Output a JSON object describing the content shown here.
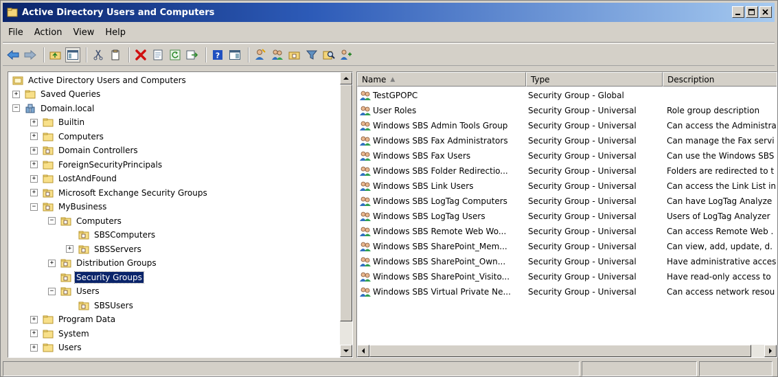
{
  "window": {
    "title": "Active Directory Users and Computers",
    "title_bar_color": "#0a246a"
  },
  "menu": {
    "items": [
      "File",
      "Action",
      "View",
      "Help"
    ]
  },
  "toolbar": {
    "icons": [
      "back-icon",
      "forward-icon",
      "up-folder-icon",
      "show-console-tree-icon",
      "cut-icon",
      "copy-icon",
      "delete-icon",
      "properties-icon",
      "refresh-icon",
      "export-list-icon",
      "help-icon",
      "show-pane-icon",
      "new-user-icon",
      "new-group-icon",
      "new-ou-icon",
      "filter-icon",
      "find-icon",
      "add-to-group-icon"
    ]
  },
  "tree": {
    "root": "Active Directory Users and Computers",
    "items": [
      {
        "label": "Active Directory Users and Computers",
        "depth": 0,
        "expander": "",
        "icon": "console-icon"
      },
      {
        "label": "Saved Queries",
        "depth": 0,
        "expander": "+",
        "icon": "folder-icon"
      },
      {
        "label": "Domain.local",
        "depth": 0,
        "expander": "−",
        "icon": "domain-icon"
      },
      {
        "label": "Builtin",
        "depth": 1,
        "expander": "+",
        "icon": "folder-icon"
      },
      {
        "label": "Computers",
        "depth": 1,
        "expander": "+",
        "icon": "folder-icon"
      },
      {
        "label": "Domain Controllers",
        "depth": 1,
        "expander": "+",
        "icon": "ou-icon"
      },
      {
        "label": "ForeignSecurityPrincipals",
        "depth": 1,
        "expander": "+",
        "icon": "folder-icon"
      },
      {
        "label": "LostAndFound",
        "depth": 1,
        "expander": "+",
        "icon": "folder-icon"
      },
      {
        "label": "Microsoft Exchange Security Groups",
        "depth": 1,
        "expander": "+",
        "icon": "ou-icon"
      },
      {
        "label": "MyBusiness",
        "depth": 1,
        "expander": "−",
        "icon": "ou-icon"
      },
      {
        "label": "Computers",
        "depth": 2,
        "expander": "−",
        "icon": "ou-icon"
      },
      {
        "label": "SBSComputers",
        "depth": 3,
        "expander": "",
        "icon": "ou-icon"
      },
      {
        "label": "SBSServers",
        "depth": 3,
        "expander": "+",
        "icon": "ou-icon"
      },
      {
        "label": "Distribution Groups",
        "depth": 2,
        "expander": "+",
        "icon": "ou-icon"
      },
      {
        "label": "Security Groups",
        "depth": 2,
        "expander": "",
        "icon": "ou-icon",
        "selected": true
      },
      {
        "label": "Users",
        "depth": 2,
        "expander": "−",
        "icon": "ou-icon"
      },
      {
        "label": "SBSUsers",
        "depth": 3,
        "expander": "",
        "icon": "ou-icon"
      },
      {
        "label": "Program Data",
        "depth": 1,
        "expander": "+",
        "icon": "folder-icon"
      },
      {
        "label": "System",
        "depth": 1,
        "expander": "+",
        "icon": "folder-icon"
      },
      {
        "label": "Users",
        "depth": 1,
        "expander": "+",
        "icon": "folder-icon"
      }
    ]
  },
  "list": {
    "columns": [
      "Name",
      "Type",
      "Description"
    ],
    "sort_indicator": "▲",
    "rows": [
      {
        "name": "TestGPOPC",
        "type": "Security Group - Global",
        "description": ""
      },
      {
        "name": "User Roles",
        "type": "Security Group - Universal",
        "description": "Role group description"
      },
      {
        "name": "Windows SBS Admin Tools Group",
        "type": "Security Group - Universal",
        "description": "Can access the Administra"
      },
      {
        "name": "Windows SBS Fax Administrators",
        "type": "Security Group - Universal",
        "description": "Can manage the Fax servi"
      },
      {
        "name": "Windows SBS Fax Users",
        "type": "Security Group - Universal",
        "description": "Can use the Windows SBS"
      },
      {
        "name": "Windows SBS Folder Redirectio...",
        "type": "Security Group - Universal",
        "description": "Folders are redirected to t"
      },
      {
        "name": "Windows SBS Link Users",
        "type": "Security Group - Universal",
        "description": "Can access the Link List in"
      },
      {
        "name": "Windows SBS LogTag Computers",
        "type": "Security Group - Universal",
        "description": "Can have LogTag Analyze"
      },
      {
        "name": "Windows SBS LogTag Users",
        "type": "Security Group - Universal",
        "description": "Users of LogTag Analyzer"
      },
      {
        "name": "Windows SBS Remote Web Wo...",
        "type": "Security Group - Universal",
        "description": "Can access Remote Web ."
      },
      {
        "name": "Windows SBS SharePoint_Mem...",
        "type": "Security Group - Universal",
        "description": "Can view, add, update, d."
      },
      {
        "name": "Windows SBS SharePoint_Own...",
        "type": "Security Group - Universal",
        "description": "Have administrative acces"
      },
      {
        "name": "Windows SBS SharePoint_Visito...",
        "type": "Security Group - Universal",
        "description": "Have read-only access to"
      },
      {
        "name": "Windows SBS Virtual Private Ne...",
        "type": "Security Group - Universal",
        "description": "Can access network resou"
      }
    ]
  }
}
